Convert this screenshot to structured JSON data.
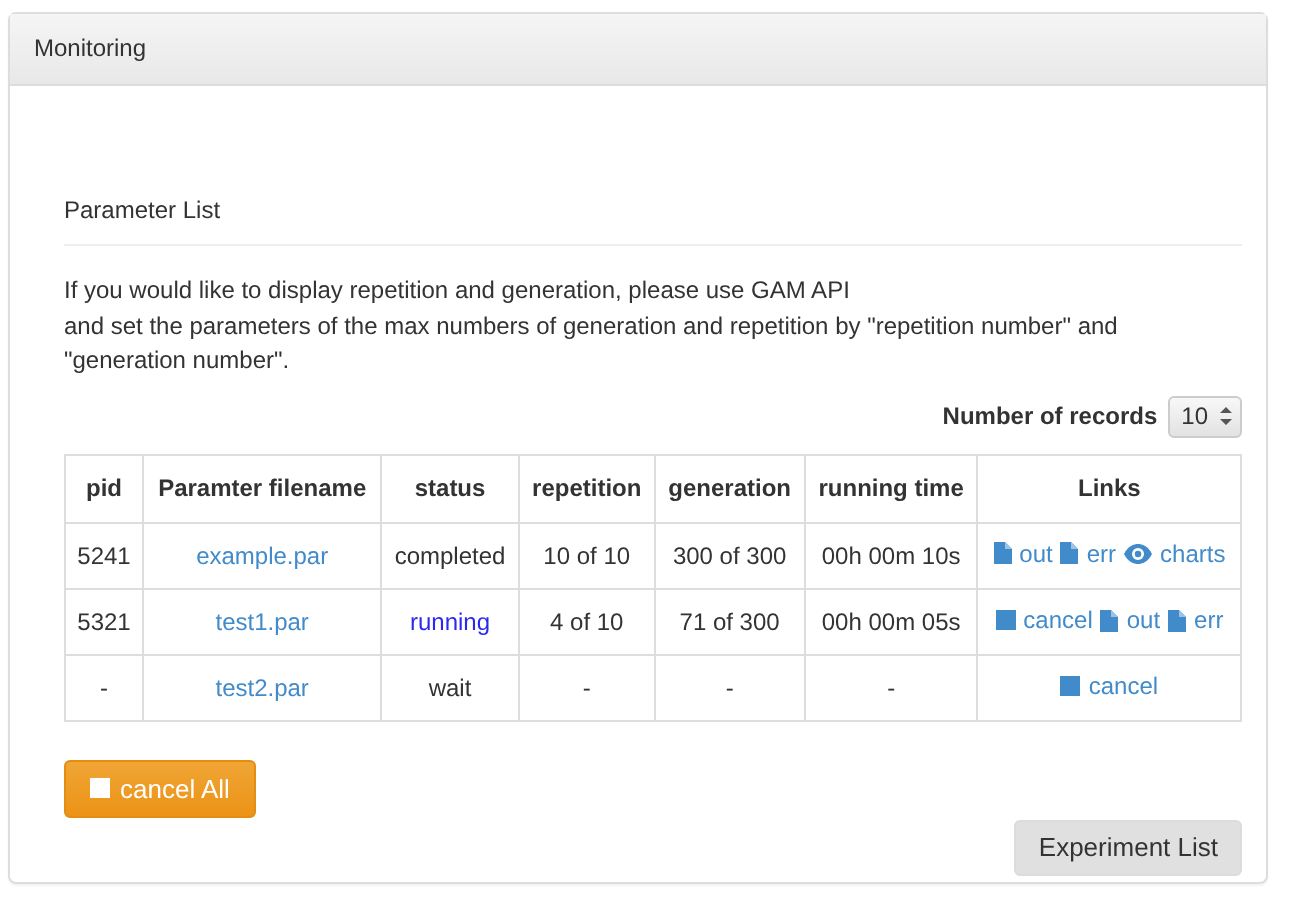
{
  "panel": {
    "title": "Monitoring"
  },
  "section": {
    "title": "Parameter List"
  },
  "notice": [
    "If you would like to display repetition and generation, please use GAM API",
    "and set the parameters of the max numbers of generation and repetition by \"repetition number\" and \"generation number\"."
  ],
  "records": {
    "label": "Number of records",
    "value": "10"
  },
  "table": {
    "columns": [
      "pid",
      "Paramter filename",
      "status",
      "repetition",
      "generation",
      "running time",
      "Links"
    ],
    "rows": [
      {
        "pid": "5241",
        "filename": "example.par",
        "status": {
          "text": "completed",
          "kind": "done"
        },
        "repetition": "10 of 10",
        "generation": "300 of 300",
        "running_time": "00h 00m 10s",
        "links": [
          {
            "kind": "file",
            "label": "out"
          },
          {
            "kind": "file",
            "label": "err"
          },
          {
            "kind": "eye",
            "label": "charts"
          }
        ]
      },
      {
        "pid": "5321",
        "filename": "test1.par",
        "status": {
          "text": "running",
          "kind": "running"
        },
        "repetition": "4 of 10",
        "generation": "71 of 300",
        "running_time": "00h 00m 05s",
        "links": [
          {
            "kind": "stop",
            "label": "cancel"
          },
          {
            "kind": "file",
            "label": "out"
          },
          {
            "kind": "file",
            "label": "err"
          }
        ]
      },
      {
        "pid": "-",
        "filename": "test2.par",
        "status": {
          "text": "wait",
          "kind": "wait"
        },
        "repetition": "-",
        "generation": "-",
        "running_time": "-",
        "links": [
          {
            "kind": "stop",
            "label": "cancel"
          }
        ]
      }
    ]
  },
  "buttons": {
    "cancel_all": "cancel All",
    "experiment_list": "Experiment List"
  }
}
